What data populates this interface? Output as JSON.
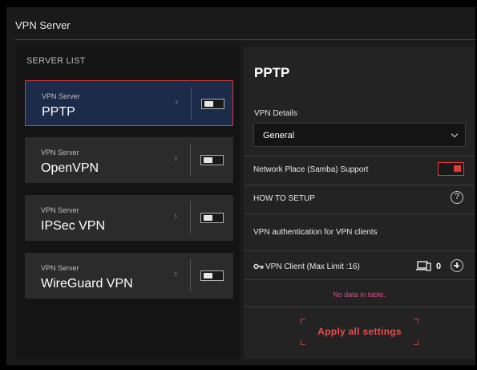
{
  "window": {
    "title": "VPN Server"
  },
  "server_list": {
    "label": "SERVER LIST",
    "items": [
      {
        "sub": "VPN Server",
        "name": "PPTP",
        "selected": true,
        "enabled": false
      },
      {
        "sub": "VPN Server",
        "name": "OpenVPN",
        "selected": false,
        "enabled": false
      },
      {
        "sub": "VPN Server",
        "name": "IPSec VPN",
        "selected": false,
        "enabled": false
      },
      {
        "sub": "VPN Server",
        "name": "WireGuard VPN",
        "selected": false,
        "enabled": false
      }
    ]
  },
  "detail": {
    "title": "PPTP",
    "details_label": "VPN Details",
    "details_select": "General",
    "samba_label": "Network Place (Samba) Support",
    "samba_enabled": true,
    "howto_label": "HOW TO SETUP",
    "auth_label": "VPN authentication for VPN clients",
    "client_label": "VPN Client (Max Limit :16)",
    "client_count": "0",
    "empty_text": "No data in table.",
    "apply_label": "Apply all settings"
  },
  "icons": {
    "chevron": "chevron-right-icon",
    "help": "help-circle-icon",
    "key": "key-icon",
    "device": "devices-icon",
    "add": "add-circle-icon"
  },
  "colors": {
    "accent": "#d13a3a",
    "selected_bg": "#1d2b4b",
    "empty_text": "#e24a8a"
  }
}
